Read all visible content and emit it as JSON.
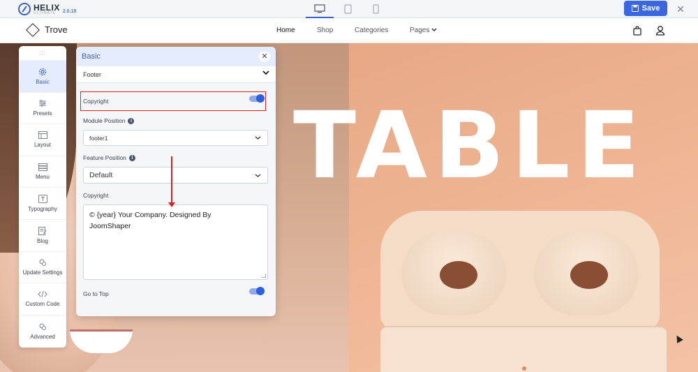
{
  "helix": {
    "brand": "HELIX",
    "sub": "ULTIMATE",
    "version": "2.0.18",
    "save_label": "Save"
  },
  "site": {
    "brand": "Trove",
    "nav": [
      "Home",
      "Shop",
      "Categories",
      "Pages"
    ]
  },
  "hero": {
    "headline": "TABLE"
  },
  "rail": {
    "grip": ":::",
    "items": [
      {
        "label": "Basic",
        "icon": "gear-icon"
      },
      {
        "label": "Presets",
        "icon": "sliders-icon"
      },
      {
        "label": "Layout",
        "icon": "layout-icon"
      },
      {
        "label": "Menu",
        "icon": "menu-icon"
      },
      {
        "label": "Typography",
        "icon": "typography-icon"
      },
      {
        "label": "Blog",
        "icon": "blog-icon"
      },
      {
        "label": "Update Settings",
        "icon": "update-settings-icon"
      },
      {
        "label": "Custom Code",
        "icon": "code-icon"
      },
      {
        "label": "Advanced",
        "icon": "advanced-icon"
      }
    ]
  },
  "panel": {
    "title": "Basic",
    "section": "Footer",
    "copyright_toggle_label": "Copyright",
    "copyright_toggle_on": true,
    "module_position_label": "Module Position",
    "module_position_value": "footer1",
    "feature_position_label": "Feature Position",
    "feature_position_value": "Default",
    "copyright_text_label": "Copyright",
    "copyright_text_line1": "© {year} Your Company. Designed By",
    "copyright_text_line2": "JoomShaper",
    "go_to_top_label": "Go to Top",
    "go_to_top_on": true
  },
  "colors": {
    "accent": "#3a63c8",
    "save": "#3a67e0",
    "highlight": "#e02020"
  }
}
